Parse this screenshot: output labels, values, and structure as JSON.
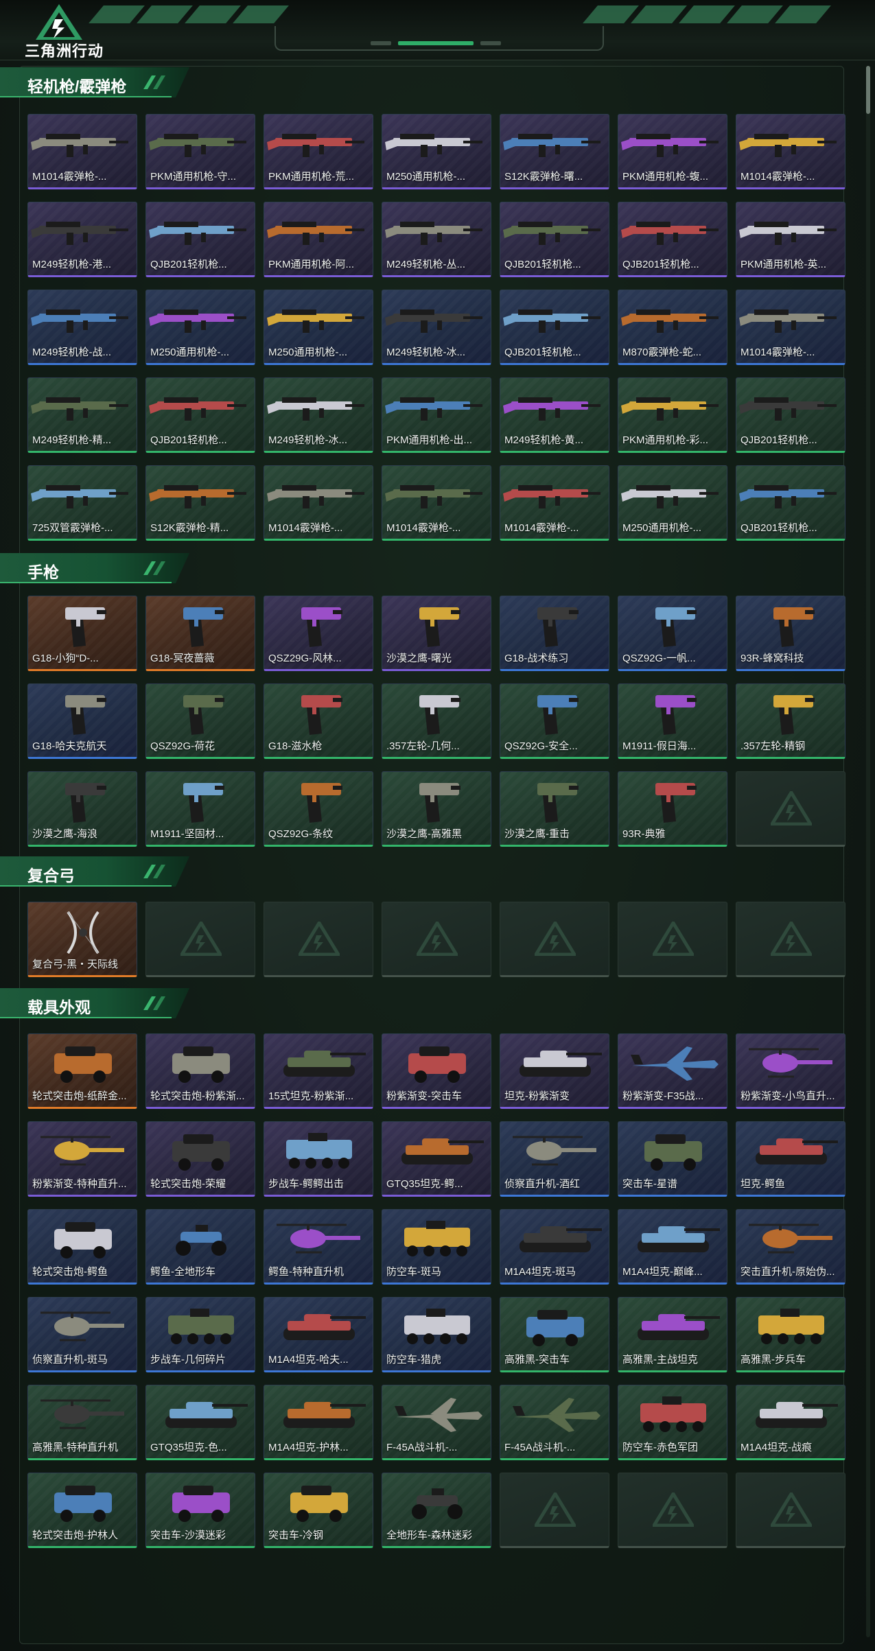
{
  "app": {
    "logo_text": "三角洲行动",
    "logo_name": "delta-force-logo"
  },
  "colors": {
    "purple": "#7a5cd6",
    "blue": "#3d77d6",
    "green": "#33b56a",
    "orange": "#e07b28",
    "accent": "#3ab56e"
  },
  "sections": [
    {
      "id": "lmg-shotgun",
      "title": "轻机枪/霰弹枪",
      "items": [
        {
          "name": "M1014霰弹枪-...",
          "rarity": "purple",
          "kind": "long"
        },
        {
          "name": "PKM通用机枪-守...",
          "rarity": "purple",
          "kind": "long"
        },
        {
          "name": "PKM通用机枪-荒...",
          "rarity": "purple",
          "kind": "long"
        },
        {
          "name": "M250通用机枪-...",
          "rarity": "purple",
          "kind": "long"
        },
        {
          "name": "S12K霰弹枪-曙...",
          "rarity": "purple",
          "kind": "long"
        },
        {
          "name": "PKM通用机枪-蝮...",
          "rarity": "purple",
          "kind": "long"
        },
        {
          "name": "M1014霰弹枪-...",
          "rarity": "purple",
          "kind": "long"
        },
        {
          "name": "M249轻机枪-港...",
          "rarity": "purple",
          "kind": "long"
        },
        {
          "name": "QJB201轻机枪...",
          "rarity": "purple",
          "kind": "long"
        },
        {
          "name": "PKM通用机枪-阿...",
          "rarity": "purple",
          "kind": "long"
        },
        {
          "name": "M249轻机枪-丛...",
          "rarity": "purple",
          "kind": "long"
        },
        {
          "name": "QJB201轻机枪...",
          "rarity": "purple",
          "kind": "long"
        },
        {
          "name": "QJB201轻机枪...",
          "rarity": "purple",
          "kind": "long"
        },
        {
          "name": "PKM通用机枪-英...",
          "rarity": "purple",
          "kind": "long"
        },
        {
          "name": "M249轻机枪-战...",
          "rarity": "blue",
          "kind": "long"
        },
        {
          "name": "M250通用机枪-...",
          "rarity": "blue",
          "kind": "long"
        },
        {
          "name": "M250通用机枪-...",
          "rarity": "blue",
          "kind": "long"
        },
        {
          "name": "M249轻机枪-冰...",
          "rarity": "blue",
          "kind": "long"
        },
        {
          "name": "QJB201轻机枪...",
          "rarity": "blue",
          "kind": "long"
        },
        {
          "name": "M870霰弹枪-蛇...",
          "rarity": "blue",
          "kind": "long"
        },
        {
          "name": "M1014霰弹枪-...",
          "rarity": "blue",
          "kind": "long"
        },
        {
          "name": "M249轻机枪-精...",
          "rarity": "green",
          "kind": "long"
        },
        {
          "name": "QJB201轻机枪...",
          "rarity": "green",
          "kind": "long"
        },
        {
          "name": "M249轻机枪-冰...",
          "rarity": "green",
          "kind": "long"
        },
        {
          "name": "PKM通用机枪-出...",
          "rarity": "green",
          "kind": "long"
        },
        {
          "name": "M249轻机枪-黄...",
          "rarity": "green",
          "kind": "long"
        },
        {
          "name": "PKM通用机枪-彩...",
          "rarity": "green",
          "kind": "long"
        },
        {
          "name": "QJB201轻机枪...",
          "rarity": "green",
          "kind": "long"
        },
        {
          "name": "725双管霰弹枪-...",
          "rarity": "green",
          "kind": "long"
        },
        {
          "name": "S12K霰弹枪-精...",
          "rarity": "green",
          "kind": "long"
        },
        {
          "name": "M1014霰弹枪-...",
          "rarity": "green",
          "kind": "long"
        },
        {
          "name": "M1014霰弹枪-...",
          "rarity": "green",
          "kind": "long"
        },
        {
          "name": "M1014霰弹枪-...",
          "rarity": "green",
          "kind": "long"
        },
        {
          "name": "M250通用机枪-...",
          "rarity": "green",
          "kind": "long"
        },
        {
          "name": "QJB201轻机枪...",
          "rarity": "green",
          "kind": "long"
        }
      ]
    },
    {
      "id": "pistol",
      "title": "手枪",
      "items": [
        {
          "name": "G18-小狗“D-...",
          "rarity": "orange",
          "kind": "pistol"
        },
        {
          "name": "G18-冥夜蔷薇",
          "rarity": "orange",
          "kind": "pistol"
        },
        {
          "name": "QSZ29G-风林...",
          "rarity": "purple",
          "kind": "pistol"
        },
        {
          "name": "沙漠之鹰-曙光",
          "rarity": "purple",
          "kind": "pistol"
        },
        {
          "name": "G18-战术练习",
          "rarity": "blue",
          "kind": "pistol"
        },
        {
          "name": "QSZ92G-一帆...",
          "rarity": "blue",
          "kind": "pistol"
        },
        {
          "name": "93R-蜂窝科技",
          "rarity": "blue",
          "kind": "pistol"
        },
        {
          "name": "G18-哈夫克航天",
          "rarity": "blue",
          "kind": "pistol"
        },
        {
          "name": "QSZ92G-荷花",
          "rarity": "green",
          "kind": "pistol"
        },
        {
          "name": "G18-滋水枪",
          "rarity": "green",
          "kind": "pistol"
        },
        {
          "name": ".357左轮-几何...",
          "rarity": "green",
          "kind": "pistol"
        },
        {
          "name": "QSZ92G-安全...",
          "rarity": "green",
          "kind": "pistol"
        },
        {
          "name": "M1911-假日海...",
          "rarity": "green",
          "kind": "pistol"
        },
        {
          "name": ".357左轮-精钢",
          "rarity": "green",
          "kind": "pistol"
        },
        {
          "name": "沙漠之鹰-海浪",
          "rarity": "green",
          "kind": "pistol"
        },
        {
          "name": "M1911-坚固材...",
          "rarity": "green",
          "kind": "pistol"
        },
        {
          "name": "QSZ92G-条纹",
          "rarity": "green",
          "kind": "pistol"
        },
        {
          "name": "沙漠之鹰-高雅黑",
          "rarity": "green",
          "kind": "pistol"
        },
        {
          "name": "沙漠之鹰-重击",
          "rarity": "green",
          "kind": "pistol"
        },
        {
          "name": "93R-典雅",
          "rarity": "green",
          "kind": "pistol"
        },
        {
          "name": "",
          "rarity": "empty",
          "kind": "empty"
        }
      ]
    },
    {
      "id": "bow",
      "title": "复合弓",
      "items": [
        {
          "name": "复合弓-黑・天际线",
          "rarity": "orange",
          "kind": "bow"
        },
        {
          "name": "",
          "rarity": "empty",
          "kind": "empty"
        },
        {
          "name": "",
          "rarity": "empty",
          "kind": "empty"
        },
        {
          "name": "",
          "rarity": "empty",
          "kind": "empty"
        },
        {
          "name": "",
          "rarity": "empty",
          "kind": "empty"
        },
        {
          "name": "",
          "rarity": "empty",
          "kind": "empty"
        },
        {
          "name": "",
          "rarity": "empty",
          "kind": "empty"
        }
      ]
    },
    {
      "id": "vehicle",
      "title": "载具外观",
      "items": [
        {
          "name": "轮式突击炮-纸醉金...",
          "rarity": "orange",
          "kind": "car"
        },
        {
          "name": "轮式突击炮-粉紫渐...",
          "rarity": "purple",
          "kind": "car"
        },
        {
          "name": "15式坦克-粉紫渐...",
          "rarity": "purple",
          "kind": "tank"
        },
        {
          "name": "粉紫渐变-突击车",
          "rarity": "purple",
          "kind": "car"
        },
        {
          "name": "坦克-粉紫渐变",
          "rarity": "purple",
          "kind": "tank"
        },
        {
          "name": "粉紫渐变-F35战...",
          "rarity": "purple",
          "kind": "jet"
        },
        {
          "name": "粉紫渐变-小鸟直升...",
          "rarity": "purple",
          "kind": "heli"
        },
        {
          "name": "粉紫渐变-特种直升...",
          "rarity": "purple",
          "kind": "heli"
        },
        {
          "name": "轮式突击炮-荣耀",
          "rarity": "purple",
          "kind": "car"
        },
        {
          "name": "步战车-鳄鳄出击",
          "rarity": "purple",
          "kind": "apc"
        },
        {
          "name": "GTQ35坦克-鳄...",
          "rarity": "purple",
          "kind": "tank"
        },
        {
          "name": "侦察直升机-酒红",
          "rarity": "blue",
          "kind": "heli"
        },
        {
          "name": "突击车-星谱",
          "rarity": "blue",
          "kind": "car"
        },
        {
          "name": "坦克-鳄鱼",
          "rarity": "blue",
          "kind": "tank"
        },
        {
          "name": "轮式突击炮-鳄鱼",
          "rarity": "blue",
          "kind": "car"
        },
        {
          "name": "鳄鱼-全地形车",
          "rarity": "blue",
          "kind": "atv"
        },
        {
          "name": "鳄鱼-特种直升机",
          "rarity": "blue",
          "kind": "heli"
        },
        {
          "name": "防空车-斑马",
          "rarity": "blue",
          "kind": "apc"
        },
        {
          "name": "M1A4坦克-斑马",
          "rarity": "blue",
          "kind": "tank"
        },
        {
          "name": "M1A4坦克-巅峰...",
          "rarity": "blue",
          "kind": "tank"
        },
        {
          "name": "突击直升机-原始伪...",
          "rarity": "blue",
          "kind": "heli"
        },
        {
          "name": "侦察直升机-斑马",
          "rarity": "blue",
          "kind": "heli"
        },
        {
          "name": "步战车-几何碎片",
          "rarity": "blue",
          "kind": "apc"
        },
        {
          "name": "M1A4坦克-哈夫...",
          "rarity": "blue",
          "kind": "tank"
        },
        {
          "name": "防空车-猎虎",
          "rarity": "blue",
          "kind": "apc"
        },
        {
          "name": "高雅黑-突击车",
          "rarity": "green",
          "kind": "car"
        },
        {
          "name": "高雅黑-主战坦克",
          "rarity": "green",
          "kind": "tank"
        },
        {
          "name": "高雅黑-步兵车",
          "rarity": "green",
          "kind": "apc"
        },
        {
          "name": "高雅黑-特种直升机",
          "rarity": "green",
          "kind": "heli"
        },
        {
          "name": "GTQ35坦克-色...",
          "rarity": "green",
          "kind": "tank"
        },
        {
          "name": "M1A4坦克-护林...",
          "rarity": "green",
          "kind": "tank"
        },
        {
          "name": "F-45A战斗机-...",
          "rarity": "green",
          "kind": "jet"
        },
        {
          "name": "F-45A战斗机-...",
          "rarity": "green",
          "kind": "jet"
        },
        {
          "name": "防空车-赤色军团",
          "rarity": "green",
          "kind": "apc"
        },
        {
          "name": "M1A4坦克-战痕",
          "rarity": "green",
          "kind": "tank"
        },
        {
          "name": "轮式突击炮-护林人",
          "rarity": "green",
          "kind": "car"
        },
        {
          "name": "突击车-沙漠迷彩",
          "rarity": "green",
          "kind": "car"
        },
        {
          "name": "突击车-冷钢",
          "rarity": "green",
          "kind": "car"
        },
        {
          "name": "全地形车-森林迷彩",
          "rarity": "green",
          "kind": "atv"
        },
        {
          "name": "",
          "rarity": "empty",
          "kind": "empty"
        },
        {
          "name": "",
          "rarity": "empty",
          "kind": "empty"
        },
        {
          "name": "",
          "rarity": "empty",
          "kind": "empty"
        }
      ]
    }
  ]
}
